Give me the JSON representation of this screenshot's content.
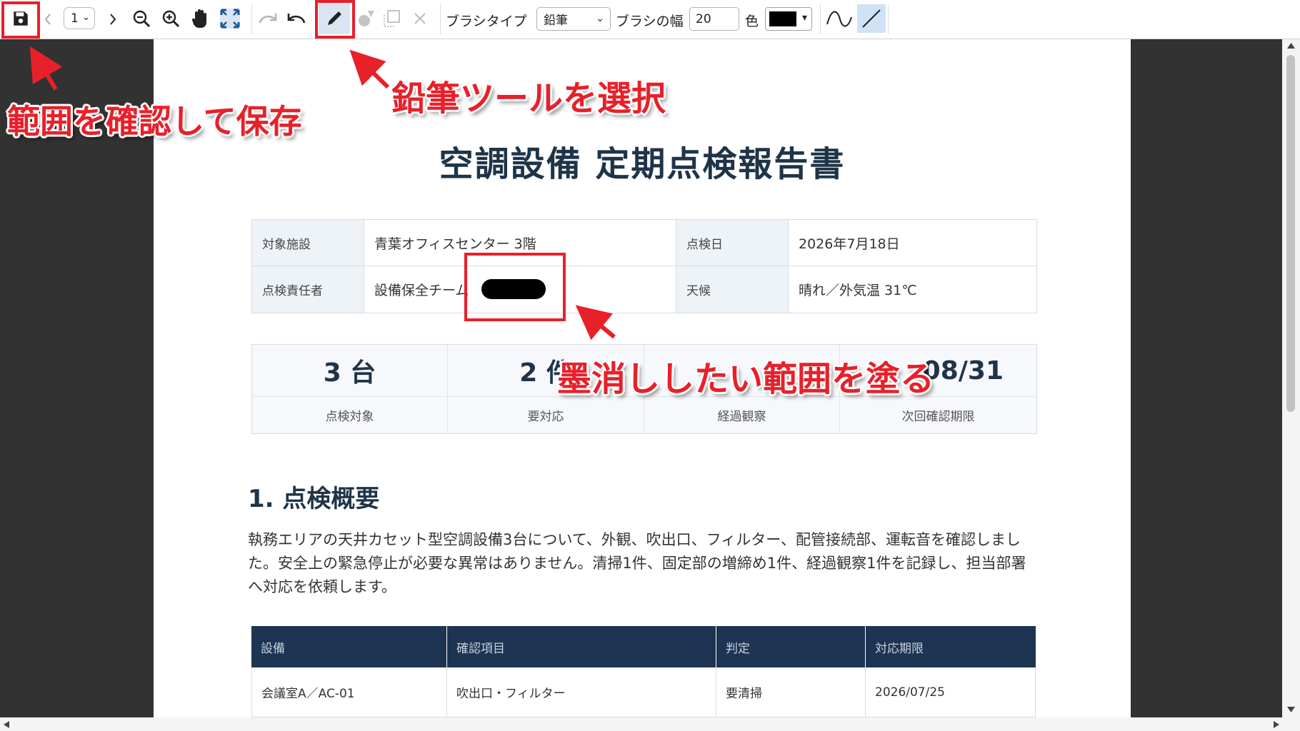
{
  "toolbar": {
    "page_value": "1",
    "brush_type_label": "ブラシタイプ",
    "brush_type_value": "鉛筆",
    "brush_width_label": "ブラシの幅",
    "brush_width_value": "20",
    "color_label": "色",
    "color_value": "#000000"
  },
  "document": {
    "title": "空調設備  定期点検報告書",
    "info": {
      "facility_label": "対象施設",
      "facility_value": "青葉オフィスセンター 3階",
      "date_label": "点検日",
      "date_value": "2026年7月18日",
      "person_label": "点検責任者",
      "person_value": "設備保全チーム",
      "weather_label": "天候",
      "weather_value": "晴れ／外気温 31℃"
    },
    "stats": [
      {
        "value": "3 台",
        "label": "点検対象"
      },
      {
        "value": "2 件",
        "label": "要対応"
      },
      {
        "value": "",
        "label": "経過観察"
      },
      {
        "value": "08/31",
        "label": "次回確認期限"
      }
    ],
    "section1_heading": "1.  点検概要",
    "section1_text": "執務エリアの天井カセット型空調設備3台について、外観、吹出口、フィルター、配管接続部、運転音を確認しました。安全上の緊急停止が必要な異常はありません。清掃1件、固定部の増締め1件、経過観察1件を記録し、担当部署へ対応を依頼します。",
    "table": {
      "headers": [
        "設備",
        "確認項目",
        "判定",
        "対応期限"
      ],
      "rows": [
        [
          "会議室A／AC-01",
          "吹出口・フィルター",
          "要清掃",
          "2026/07/25"
        ]
      ]
    }
  },
  "annotations": {
    "save": "範囲を確認して保存",
    "pencil": "鉛筆ツールを選択",
    "paint": "墨消ししたい範囲を塗る"
  },
  "colors": {
    "accent_red": "#e8202a",
    "navy": "#1d3452",
    "viewer_bg": "#323232"
  }
}
